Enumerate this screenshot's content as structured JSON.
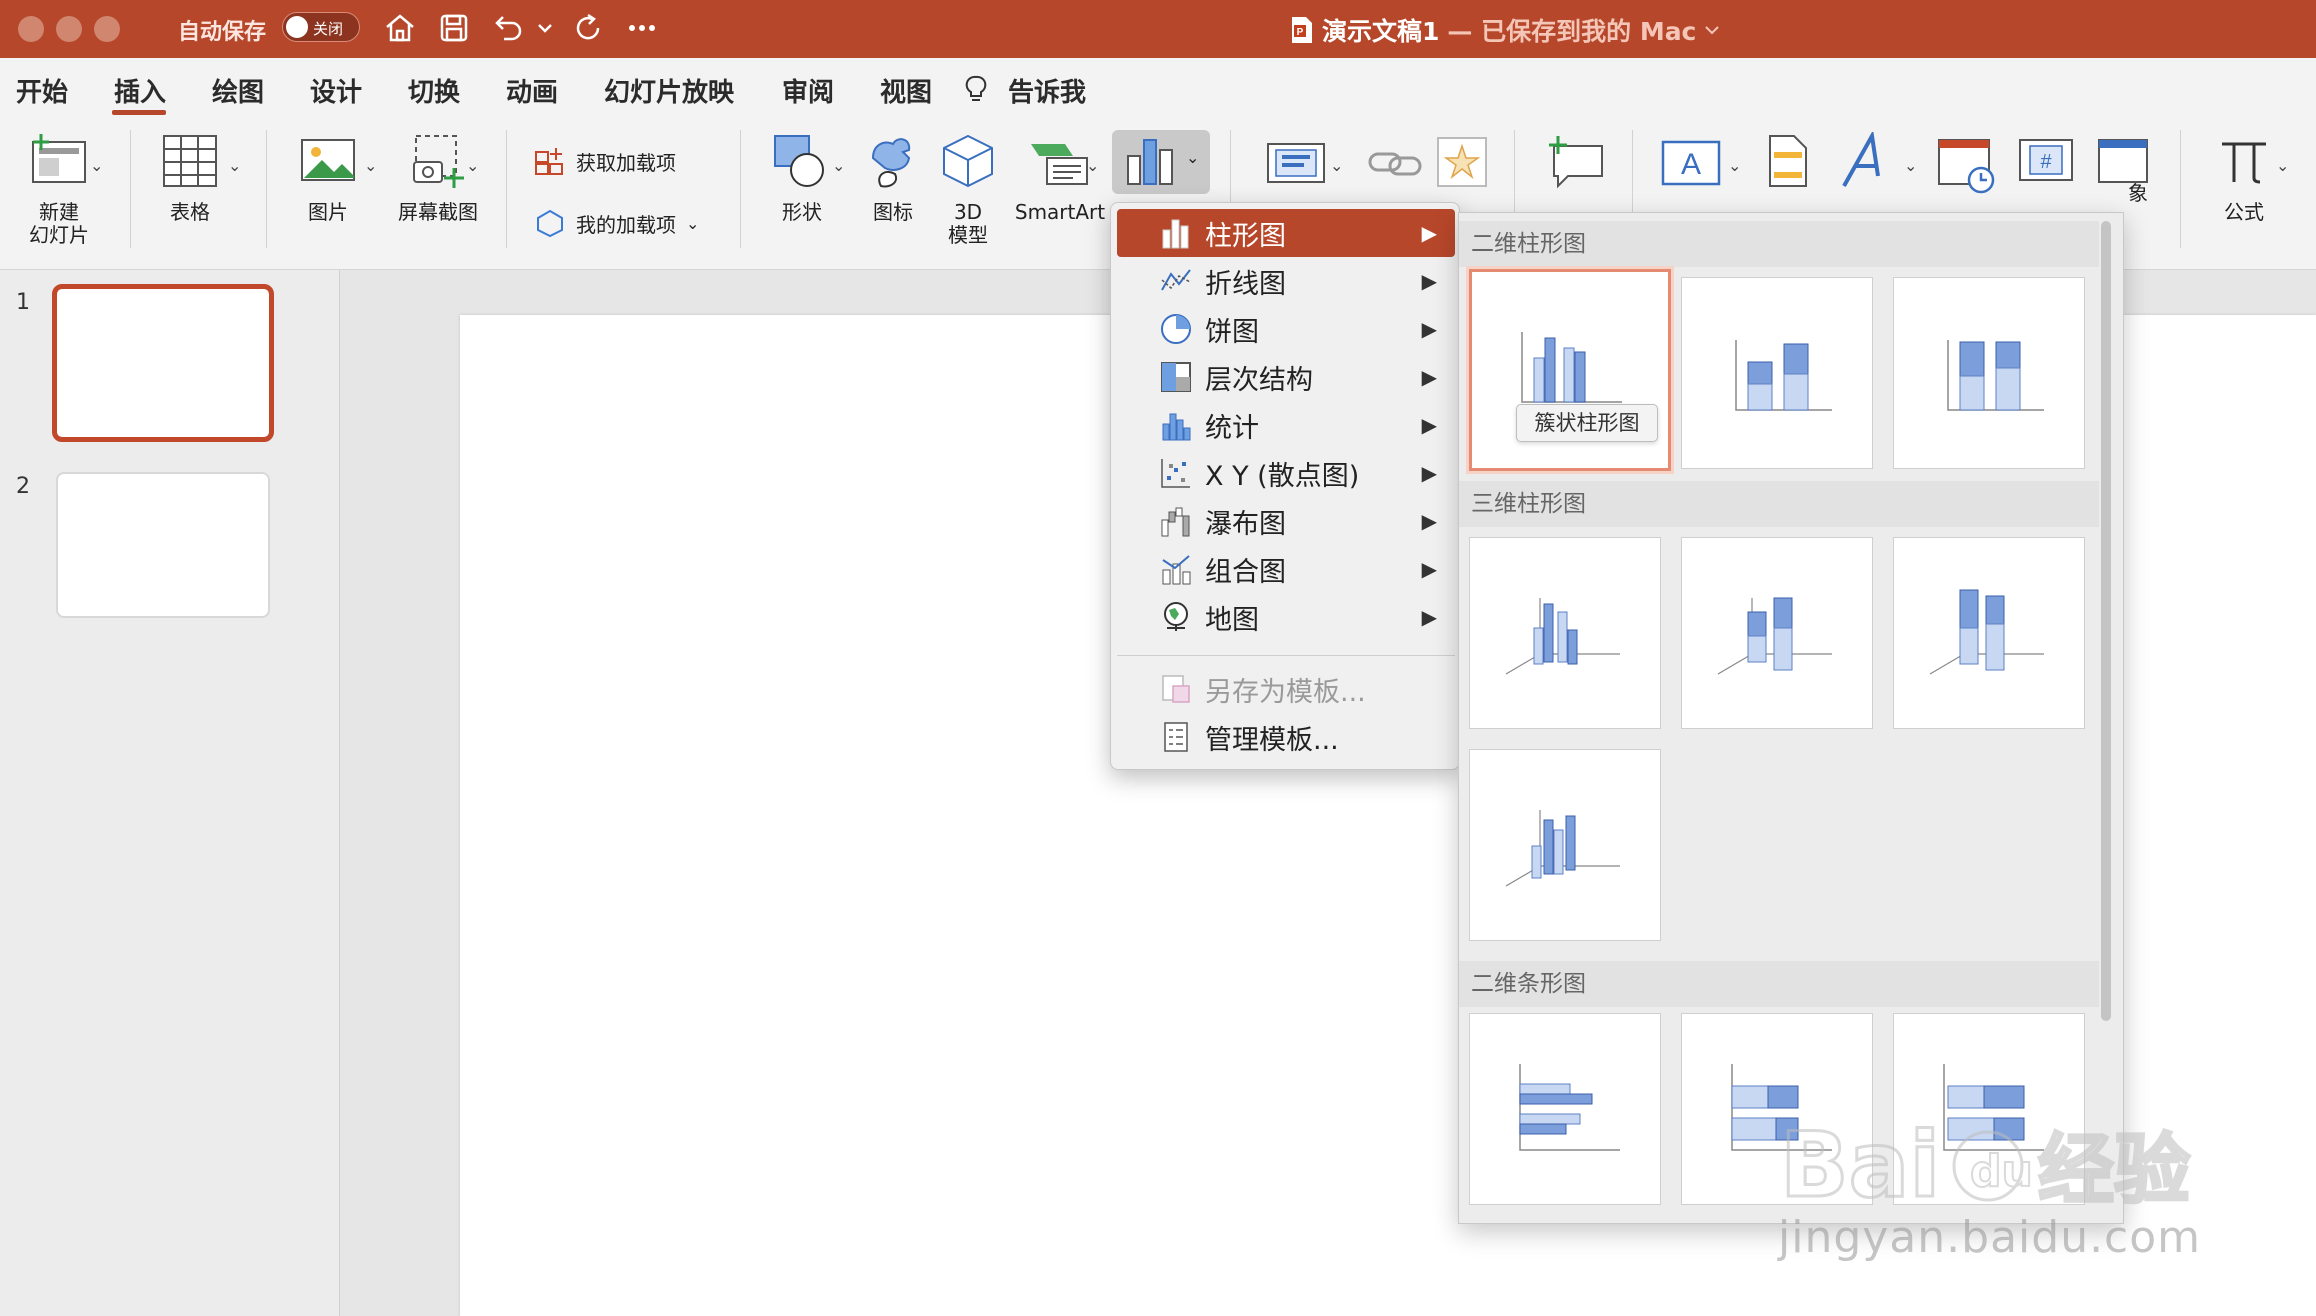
{
  "titlebar": {
    "autosave_label": "自动保存",
    "autosave_state": "关闭",
    "doc_name": "演示文稿1",
    "save_status": "— 已保存到我的 Mac",
    "accent": "#b7472a"
  },
  "menu": {
    "tabs": [
      "开始",
      "插入",
      "绘图",
      "设计",
      "切换",
      "动画",
      "幻灯片放映",
      "审阅",
      "视图",
      "告诉我"
    ],
    "active_tab": "插入"
  },
  "ribbon": {
    "new_slide": "新建\n幻灯片",
    "table": "表格",
    "picture": "图片",
    "screenshot": "屏幕截图",
    "get_addins": "获取加载项",
    "my_addins": "我的加载项",
    "shapes": "形状",
    "icons": "图标",
    "model3d": "3D\n模型",
    "smartart": "SmartArt",
    "object_partial": "象",
    "equation": "公式"
  },
  "slides": {
    "numbers": [
      "1",
      "2"
    ],
    "selected": "1"
  },
  "chart_menu": {
    "items": [
      {
        "label": "柱形图",
        "icon": "column-chart-icon",
        "has_submenu": true,
        "highlighted": true
      },
      {
        "label": "折线图",
        "icon": "line-chart-icon",
        "has_submenu": true
      },
      {
        "label": "饼图",
        "icon": "pie-chart-icon",
        "has_submenu": true
      },
      {
        "label": "层次结构",
        "icon": "hierarchy-chart-icon",
        "has_submenu": true
      },
      {
        "label": "统计",
        "icon": "statistic-chart-icon",
        "has_submenu": true
      },
      {
        "label": "X Y (散点图)",
        "icon": "scatter-chart-icon",
        "has_submenu": true
      },
      {
        "label": "瀑布图",
        "icon": "waterfall-chart-icon",
        "has_submenu": true
      },
      {
        "label": "组合图",
        "icon": "combo-chart-icon",
        "has_submenu": true
      },
      {
        "label": "地图",
        "icon": "map-chart-icon",
        "has_submenu": true
      }
    ],
    "save_template": "另存为模板...",
    "manage_templates": "管理模板..."
  },
  "gallery": {
    "section_2d_column": "二维柱形图",
    "section_3d_column": "三维柱形图",
    "section_2d_bar": "二维条形图",
    "tooltip": "簇状柱形图"
  },
  "watermark": {
    "url": "jingyan.baidu.com"
  }
}
